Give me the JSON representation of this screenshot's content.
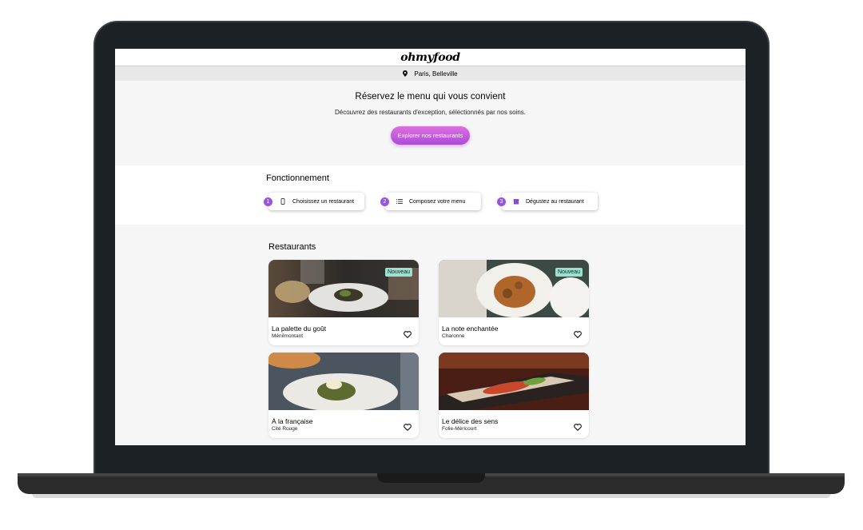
{
  "header": {
    "logo": "ohmyfood"
  },
  "location": {
    "icon": "location-pin-icon",
    "label": "Paris, Belleville"
  },
  "hero": {
    "title": "Réservez le menu qui vous convient",
    "subtitle": "Découvrez des restaurants d'exception, sélectionnés par nos soins.",
    "cta_label": "Explorer nos restaurants"
  },
  "how": {
    "title": "Fonctionnement",
    "steps": [
      {
        "number": "1",
        "icon": "phone-icon",
        "label": "Choisissez un restaurant"
      },
      {
        "number": "2",
        "icon": "list-icon",
        "label": "Composez votre menu"
      },
      {
        "number": "3",
        "icon": "store-icon",
        "label": "Dégustez au restaurant"
      }
    ]
  },
  "restaurants": {
    "title": "Restaurants",
    "items": [
      {
        "name": "La palette du goût",
        "area": "Ménilmontant",
        "badge": "Nouveau"
      },
      {
        "name": "La note enchantée",
        "area": "Charonne",
        "badge": "Nouveau"
      },
      {
        "name": "À la française",
        "area": "Cité Rouge",
        "badge": ""
      },
      {
        "name": "Le délice des sens",
        "area": "Folie-Méricourt",
        "badge": ""
      }
    ]
  },
  "colors": {
    "accent": "#9356dc",
    "cta_start": "#e06ee0",
    "cta_end": "#a94dd8",
    "badge": "#99e2d0"
  }
}
